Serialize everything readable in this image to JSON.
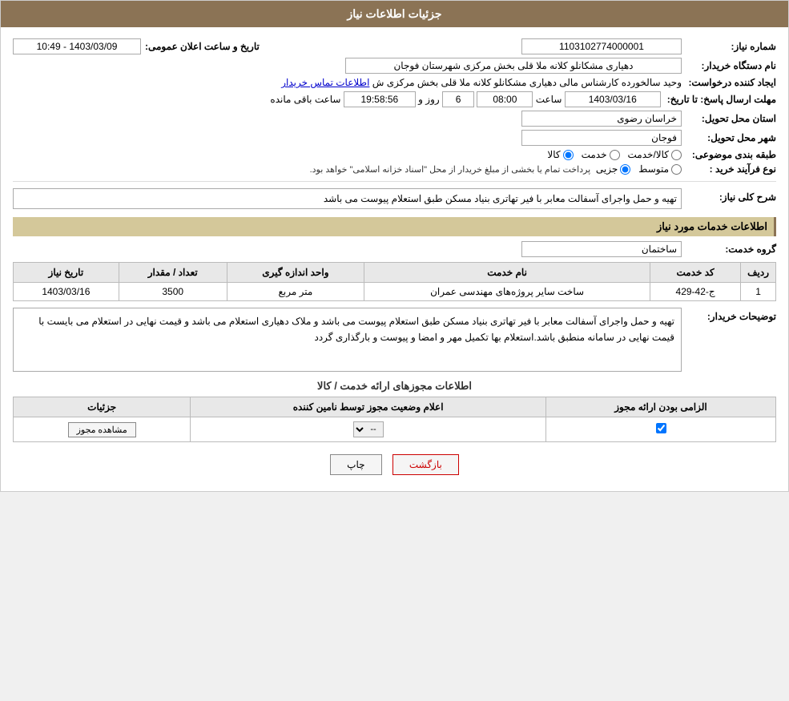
{
  "page": {
    "title": "جزئیات اطلاعات نیاز"
  },
  "header": {
    "need_number_label": "شماره نیاز:",
    "need_number_value": "1103102774000001",
    "buyer_org_label": "نام دستگاه خریدار:",
    "buyer_org_value": "دهیاری مشکانلو کلانه ملا قلی بخش مرکزی شهرستان فوجان",
    "announcement_label": "تاریخ و ساعت اعلان عمومی:",
    "announcement_value": "1403/03/09 - 10:49",
    "creator_label": "ایجاد کننده درخواست:",
    "creator_value": "وحید سالخورده کارشناس مالی دهیاری مشکانلو کلانه ملا قلی بخش مرکزی ش",
    "creator_link": "اطلاعات تماس خریدار",
    "deadline_label": "مهلت ارسال پاسخ: تا تاریخ:",
    "deadline_date": "1403/03/16",
    "deadline_time_label": "ساعت",
    "deadline_time": "08:00",
    "deadline_day_label": "روز و",
    "deadline_days": "6",
    "deadline_remaining_label": "ساعت باقی مانده",
    "deadline_remaining": "19:58:56",
    "province_label": "استان محل تحویل:",
    "province_value": "خراسان رضوی",
    "city_label": "شهر محل تحویل:",
    "city_value": "فوجان",
    "category_label": "طبقه بندی موضوعی:",
    "category_kala": "کالا",
    "category_khedmat": "خدمت",
    "category_kala_khedmat": "کالا/خدمت",
    "purchase_type_label": "نوع فرآیند خرید :",
    "purchase_jozei": "جزیی",
    "purchase_motavasset": "متوسط",
    "purchase_note": "پرداخت تمام یا بخشی از مبلغ خریدار از محل \"اسناد خزانه اسلامی\" خواهد بود.",
    "need_desc_label": "شرح کلی نیاز:",
    "need_desc_value": "تهیه و حمل واجرای آسفالت معابر با فیر تهاتری بنیاد مسکن طبق استعلام پیوست می باشد",
    "services_section": "اطلاعات خدمات مورد نیاز",
    "service_group_label": "گروه خدمت:",
    "service_group_value": "ساختمان",
    "table": {
      "col_radif": "ردیف",
      "col_code": "کد خدمت",
      "col_name": "نام خدمت",
      "col_unit": "واحد اندازه گیری",
      "col_count": "تعداد / مقدار",
      "col_date": "تاریخ نیاز",
      "rows": [
        {
          "radif": "1",
          "code": "ج-42-429",
          "name": "ساخت سایر پروژه‌های مهندسی عمران",
          "unit": "متر مربع",
          "count": "3500",
          "date": "1403/03/16"
        }
      ]
    },
    "buyer_notes_label": "توضیحات خریدار:",
    "buyer_notes_value": "تهیه و حمل واجرای آسفالت معابر با فیر تهاتری بنیاد مسکن طبق استعلام پیوست می باشد و ملاک دهیاری استعلام می باشد و قیمت نهایی در استعلام می بایست با قیمت نهایی در سامانه منطبق باشد.استعلام بها تکمیل مهر و امضا و پیوست و بارگذاری گردد",
    "permits_section": "اطلاعات مجوزهای ارائه خدمت / کالا",
    "permits_table": {
      "col_required": "الزامی بودن ارائه مجوز",
      "col_status": "اعلام وضعیت مجوز توسط نامین کننده",
      "col_details": "جزئیات",
      "rows": [
        {
          "required": true,
          "status_value": "--",
          "details_btn": "مشاهده مجوز"
        }
      ]
    }
  },
  "buttons": {
    "print": "چاپ",
    "back": "بازگشت"
  }
}
